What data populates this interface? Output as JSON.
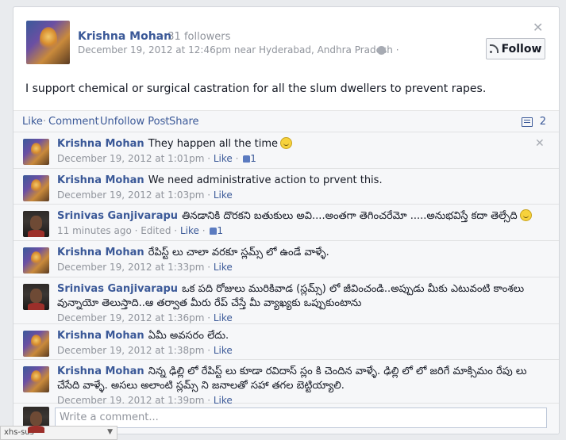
{
  "post": {
    "author": "Krishna Mohan",
    "followers": "· 31 followers",
    "date_location": "December 19, 2012 at 12:46pm near Hyderabad, Andhra Pradesh ·",
    "follow_label": "Follow",
    "text": "I support chemical or surgical castration for all the slum dwellers to prevent rapes."
  },
  "actions": {
    "like": "Like",
    "comment": "Comment",
    "unfollow": "Unfollow Post",
    "share": "Share",
    "comment_count": "2"
  },
  "comments": [
    {
      "author": "Krishna Mohan",
      "text": "They happen all the time",
      "date": "December 19, 2012 at 1:01pm",
      "like": "Like",
      "likes": "1"
    },
    {
      "author": "Krishna Mohan",
      "text": "We need administrative action to prvent this.",
      "date": "December 19, 2012 at 1:03pm",
      "like": "Like"
    },
    {
      "author": "Srinivas Ganjivarapu",
      "text": "తినడానికి దొరకని బతుకులు అవి....అంతగా తెగించరేమో .....అనుభవిస్తే కదా తెల్సేది",
      "date": "11 minutes ago · Edited ·",
      "like": "Like",
      "likes": "1"
    },
    {
      "author": "Krishna Mohan",
      "text": "రేపిస్ట్ లు చాలా వరకూ స్లమ్స్ లో ఉండే వాళ్ళే.",
      "date": "December 19, 2012 at 1:33pm",
      "like": "Like"
    },
    {
      "author": "Srinivas Ganjivarapu",
      "text": "ఒక పది రోజులు మురికివాడ (స్లమ్స్) లో జీవించండి..అప్పుడు మీకు ఎటువంటి కాంశలు వున్నాయో తెలుస్తాది..ఆ తర్వాత మీరు రేప్ చేస్తే మీ వ్యాఖ్యకు ఒప్పుకుంటాను",
      "date": "December 19, 2012 at 1:36pm",
      "like": "Like"
    },
    {
      "author": "Krishna Mohan",
      "text": "ఏమీ అవసరం లేదు.",
      "date": "December 19, 2012 at 1:38pm",
      "like": "Like"
    },
    {
      "author": "Krishna Mohan",
      "text": "నిన్న ఢిల్లి లో రేపిస్ట్ లు కూడా రవిదాస్ స్లం కి చెందిన వాళ్ళే. ఢిల్లి లో లో జరిగే మాక్సిమం రేపు లు చేసేది వాళ్ళే. అసలు అలాంటి స్లమ్స్ ని జనాలతో సహా తగల బెట్టియ్యాలి.",
      "date": "December 19, 2012 at 1:39pm",
      "like": "Like"
    }
  ],
  "write_placeholder": "Write a comment...",
  "bottom_tab": "xhs-sus",
  "icons": {
    "close": "close-icon",
    "globe": "globe-icon",
    "rss": "rss-icon",
    "comment": "comment-icon",
    "like": "thumbs-up-icon",
    "smiley": "smiley-icon"
  },
  "colors": {
    "link": "#3b5998",
    "meta": "#90949c",
    "comment_bg": "#f6f7f9"
  }
}
